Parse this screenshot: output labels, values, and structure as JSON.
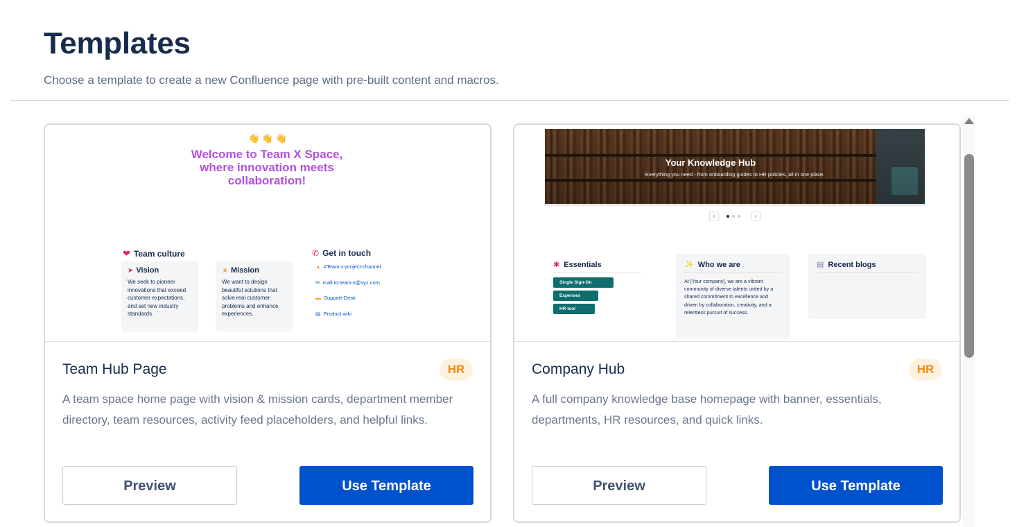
{
  "header": {
    "title": "Templates",
    "subtitle": "Choose a template to create a new Confluence page with pre-built content and macros."
  },
  "templates": [
    {
      "title": "Team Hub Page",
      "badge": "HR",
      "description": "A team space home page with vision & mission cards, department member directory, team resources, activity feed placeholders, and helpful links.",
      "preview_label": "Preview",
      "use_label": "Use Template",
      "thumbnail": {
        "wave": "👋 👋 👋",
        "welcome": "Welcome to Team X Space, where innovation meets collaboration!",
        "culture_heading": "Team culture",
        "contact_heading": "Get in touch",
        "vision": {
          "title": "Vision",
          "text": "We seek to pioneer innovations that exceed customer expectations, and set new industry standards."
        },
        "mission": {
          "title": "Mission",
          "text": "We want to design beautiful solutions that solve real customer problems and enhance experiences."
        },
        "links": [
          "#Team-x-project-channel",
          "mail to:team-x@xyz.com",
          "Support-Desk",
          "Product wiki"
        ]
      }
    },
    {
      "title": "Company Hub",
      "badge": "HR",
      "description": "A full company knowledge base homepage with banner, essentials, departments, HR resources, and quick links.",
      "preview_label": "Preview",
      "use_label": "Use Template",
      "thumbnail": {
        "banner_title": "Your Knowledge Hub",
        "banner_sub": "Everything you need - from onboarding guides to HR policies, all in one place.",
        "essentials_heading": "Essentials",
        "essentials": [
          "Single Sign-On",
          "Expenses",
          "HR tool"
        ],
        "who_heading": "Who we are",
        "who_text": "At [Your company], we are a vibrant community of diverse talents united by a shared commitment to excellence and driven by collaboration, creativity, and a relentless pursuit of success.",
        "blogs_heading": "Recent blogs"
      }
    }
  ],
  "colors": {
    "primary": "#0052cc",
    "badge_bg": "#fff1e0",
    "badge_text": "#f18d13",
    "welcome_purple": "#b44fe0",
    "chip_teal": "#0e6e6e"
  },
  "icons": {
    "heart": "heart-icon",
    "phone": "phone-icon",
    "vision": "rocket-icon",
    "mission": "star-icon",
    "essentials": "pin-icon",
    "who": "sparkle-icon",
    "blogs": "document-icon"
  }
}
